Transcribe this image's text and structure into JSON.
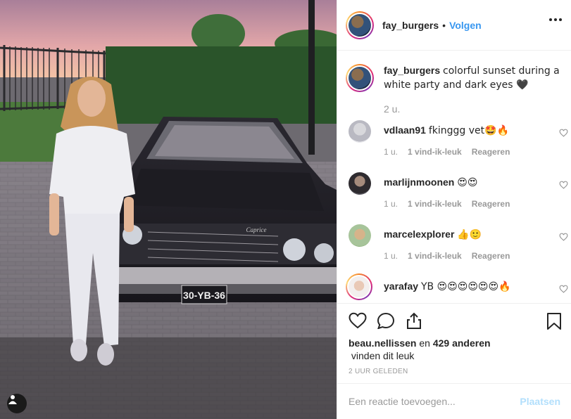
{
  "post": {
    "username": "fay_burgers",
    "separator": "•",
    "follow_label": "Volgen",
    "caption": "colorful sunset during a white party and dark eyes 🖤",
    "caption_time": "2 u.",
    "license_plate": "30-YB-36",
    "car_badge": "Caprice"
  },
  "comments": [
    {
      "username": "vdlaan91",
      "text": "fkinggg vet🤩🔥",
      "time": "1 u.",
      "likes": "1 vind-ik-leuk",
      "reply": "Reageren"
    },
    {
      "username": "marlijnmoonen",
      "text": "😍😍",
      "time": "1 u.",
      "likes": "1 vind-ik-leuk",
      "reply": "Reageren"
    },
    {
      "username": "marcelexplorer",
      "text": "👍🙂",
      "time": "1 u.",
      "likes": "1 vind-ik-leuk",
      "reply": "Reageren"
    },
    {
      "username": "yarafay",
      "text": "YB 😍😍😍😍😍😍🔥"
    }
  ],
  "likes": {
    "user": "beau.nellissen",
    "connector": "en",
    "others": "429 anderen",
    "suffix": "vinden dit leuk"
  },
  "timestamp": "2 UUR GELEDEN",
  "add_comment": {
    "placeholder": "Een reactie toevoegen...",
    "post_label": "Plaatsen"
  },
  "icons": {
    "like": "heart-icon",
    "comment": "comment-icon",
    "share": "share-icon",
    "save": "bookmark-icon",
    "options": "more-options-icon",
    "user_tag": "user-tag-icon"
  },
  "colors": {
    "link": "#3897f0",
    "post_disabled": "#b2dffc",
    "muted": "#999999"
  }
}
